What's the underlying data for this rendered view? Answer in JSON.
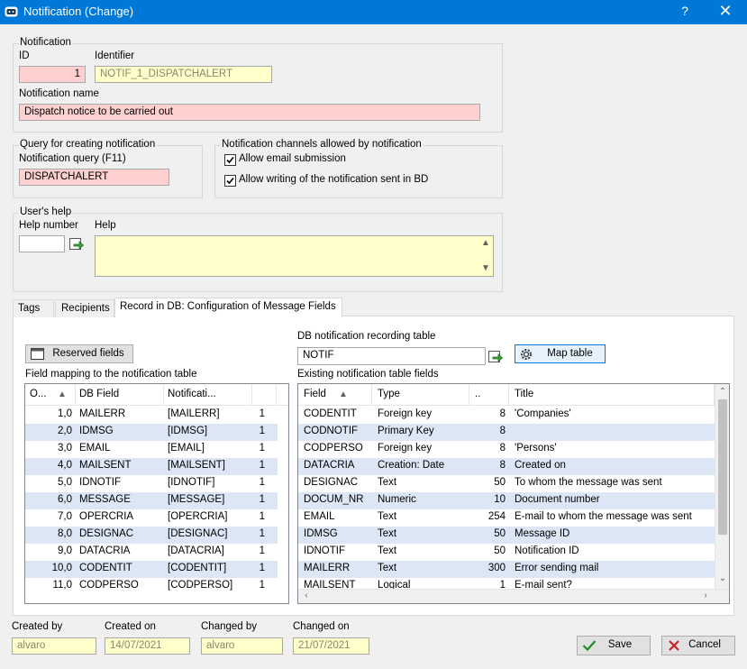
{
  "window": {
    "title": "Notification (Change)",
    "help": "?",
    "close": "✕"
  },
  "notification": {
    "group_label": "Notification",
    "id_label": "ID",
    "id_value": "1",
    "identifier_label": "Identifier",
    "identifier_value": "NOTIF_1_DISPATCHALERT",
    "name_label": "Notification name",
    "name_value": "Dispatch notice to be carried out"
  },
  "query": {
    "group_label": "Query for creating notification",
    "field_label": "Notification query (F11)",
    "value": "DISPATCHALERT"
  },
  "channels": {
    "group_label": "Notification channels allowed by notification",
    "email_label": "Allow email submission",
    "email_checked": true,
    "db_label": "Allow writing of the notification sent in BD",
    "db_checked": true
  },
  "help": {
    "group_label": "User's help",
    "number_label": "Help number",
    "number_value": "",
    "help_label": "Help",
    "help_value": ""
  },
  "tabs": [
    {
      "label": "Tags",
      "active": false
    },
    {
      "label": "Recipients",
      "active": false
    },
    {
      "label": "Record in DB: Configuration of Message Fields",
      "active": true
    }
  ],
  "reserved_button": "Reserved fields",
  "db_table": {
    "label": "DB notification recording table",
    "value": "NOTIF",
    "map_button": "Map table"
  },
  "mapping": {
    "label": "Field mapping to the notification table",
    "columns": [
      "O...",
      "DB Field",
      "Notificati...",
      ""
    ],
    "rows": [
      [
        "1,0",
        "MAILERR",
        "[MAILERR]",
        "1"
      ],
      [
        "2,0",
        "IDMSG",
        "[IDMSG]",
        "1"
      ],
      [
        "3,0",
        "EMAIL",
        "[EMAIL]",
        "1"
      ],
      [
        "4,0",
        "MAILSENT",
        "[MAILSENT]",
        "1"
      ],
      [
        "5,0",
        "IDNOTIF",
        "[IDNOTIF]",
        "1"
      ],
      [
        "6,0",
        "MESSAGE",
        "[MESSAGE]",
        "1"
      ],
      [
        "7,0",
        "OPERCRIA",
        "[OPERCRIA]",
        "1"
      ],
      [
        "8,0",
        "DESIGNAC",
        "[DESIGNAC]",
        "1"
      ],
      [
        "9,0",
        "DATACRIA",
        "[DATACRIA]",
        "1"
      ],
      [
        "10,0",
        "CODENTIT",
        "[CODENTIT]",
        "1"
      ],
      [
        "11,0",
        "CODPERSO",
        "[CODPERSO]",
        "1"
      ]
    ]
  },
  "existing": {
    "label": "Existing notification table fields",
    "columns": [
      "Field",
      "Type",
      "..",
      "Title"
    ],
    "rows": [
      [
        "CODENTIT",
        "Foreign key",
        "8",
        "'Companies'"
      ],
      [
        "CODNOTIF",
        "Primary Key",
        "8",
        ""
      ],
      [
        "CODPERSO",
        "Foreign key",
        "8",
        "'Persons'"
      ],
      [
        "DATACRIA",
        "Creation: Date",
        "8",
        "Created on"
      ],
      [
        "DESIGNAC",
        "Text",
        "50",
        "To whom the message was sent"
      ],
      [
        "DOCUM_NR",
        "Numeric",
        "10",
        "Document number"
      ],
      [
        "EMAIL",
        "Text",
        "254",
        "E-mail to whom the message was sent"
      ],
      [
        "IDMSG",
        "Text",
        "50",
        "Message ID"
      ],
      [
        "IDNOTIF",
        "Text",
        "50",
        "Notification ID"
      ],
      [
        "MAILERR",
        "Text",
        "300",
        "Error sending mail"
      ],
      [
        "MAILSENT",
        "Logical",
        "1",
        "E-mail sent?"
      ]
    ]
  },
  "audit": {
    "created_by_label": "Created by",
    "created_by": "alvaro",
    "created_on_label": "Created on",
    "created_on": "14/07/2021",
    "changed_by_label": "Changed by",
    "changed_by": "alvaro",
    "changed_on_label": "Changed on",
    "changed_on": "21/07/2021"
  },
  "buttons": {
    "save": "Save",
    "cancel": "Cancel"
  },
  "colors": {
    "titlebar": "#0078d7",
    "required": "#ffd0d0",
    "readonly": "#ffffcc",
    "alt_row": "#dce6f5"
  }
}
